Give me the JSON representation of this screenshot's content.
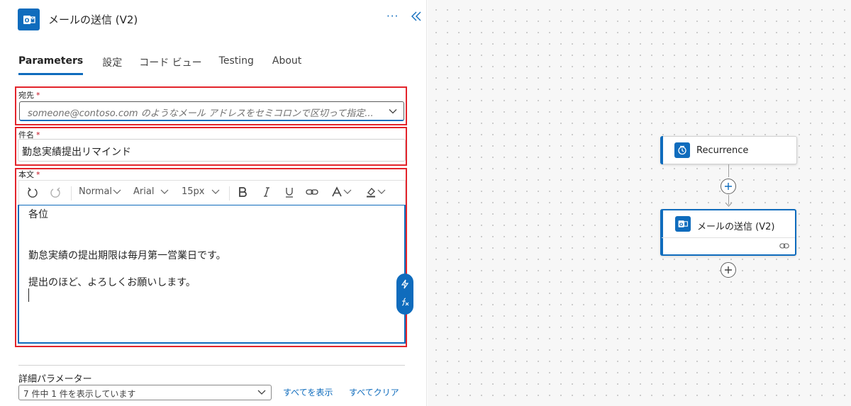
{
  "panel": {
    "title": "メールの送信 (V2)",
    "more_label": "···",
    "tabs": [
      {
        "label": "Parameters",
        "active": true
      },
      {
        "label": "設定"
      },
      {
        "label": "コード ビュー"
      },
      {
        "label": "Testing"
      },
      {
        "label": "About"
      }
    ]
  },
  "fields": {
    "to": {
      "label": "宛先",
      "required_mark": "*",
      "placeholder": "someone@contoso.com のようなメール アドレスをセミコロンで区切って指定..."
    },
    "subject": {
      "label": "件名",
      "required_mark": "*",
      "value": "勤怠実績提出リマインド"
    },
    "body": {
      "label": "本文",
      "required_mark": "*",
      "toolbar": {
        "style": "Normal",
        "font": "Arial",
        "size": "15px"
      },
      "lines": [
        "各位",
        "勤怠実績の提出期限は毎月第一営業日です。",
        "提出のほど、よろしくお願いします。"
      ]
    }
  },
  "advanced": {
    "label": "詳細パラメーター",
    "select_value": "7 件中 1 件を表示しています",
    "show_all": "すべてを表示",
    "clear_all": "すべてクリア"
  },
  "canvas": {
    "nodes": [
      {
        "label": "Recurrence",
        "icon": "clock-icon"
      },
      {
        "label": "メールの送信 (V2)",
        "icon": "outlook-icon"
      }
    ]
  },
  "colors": {
    "accent": "#0f6cbd",
    "highlight": "#e3242b"
  }
}
